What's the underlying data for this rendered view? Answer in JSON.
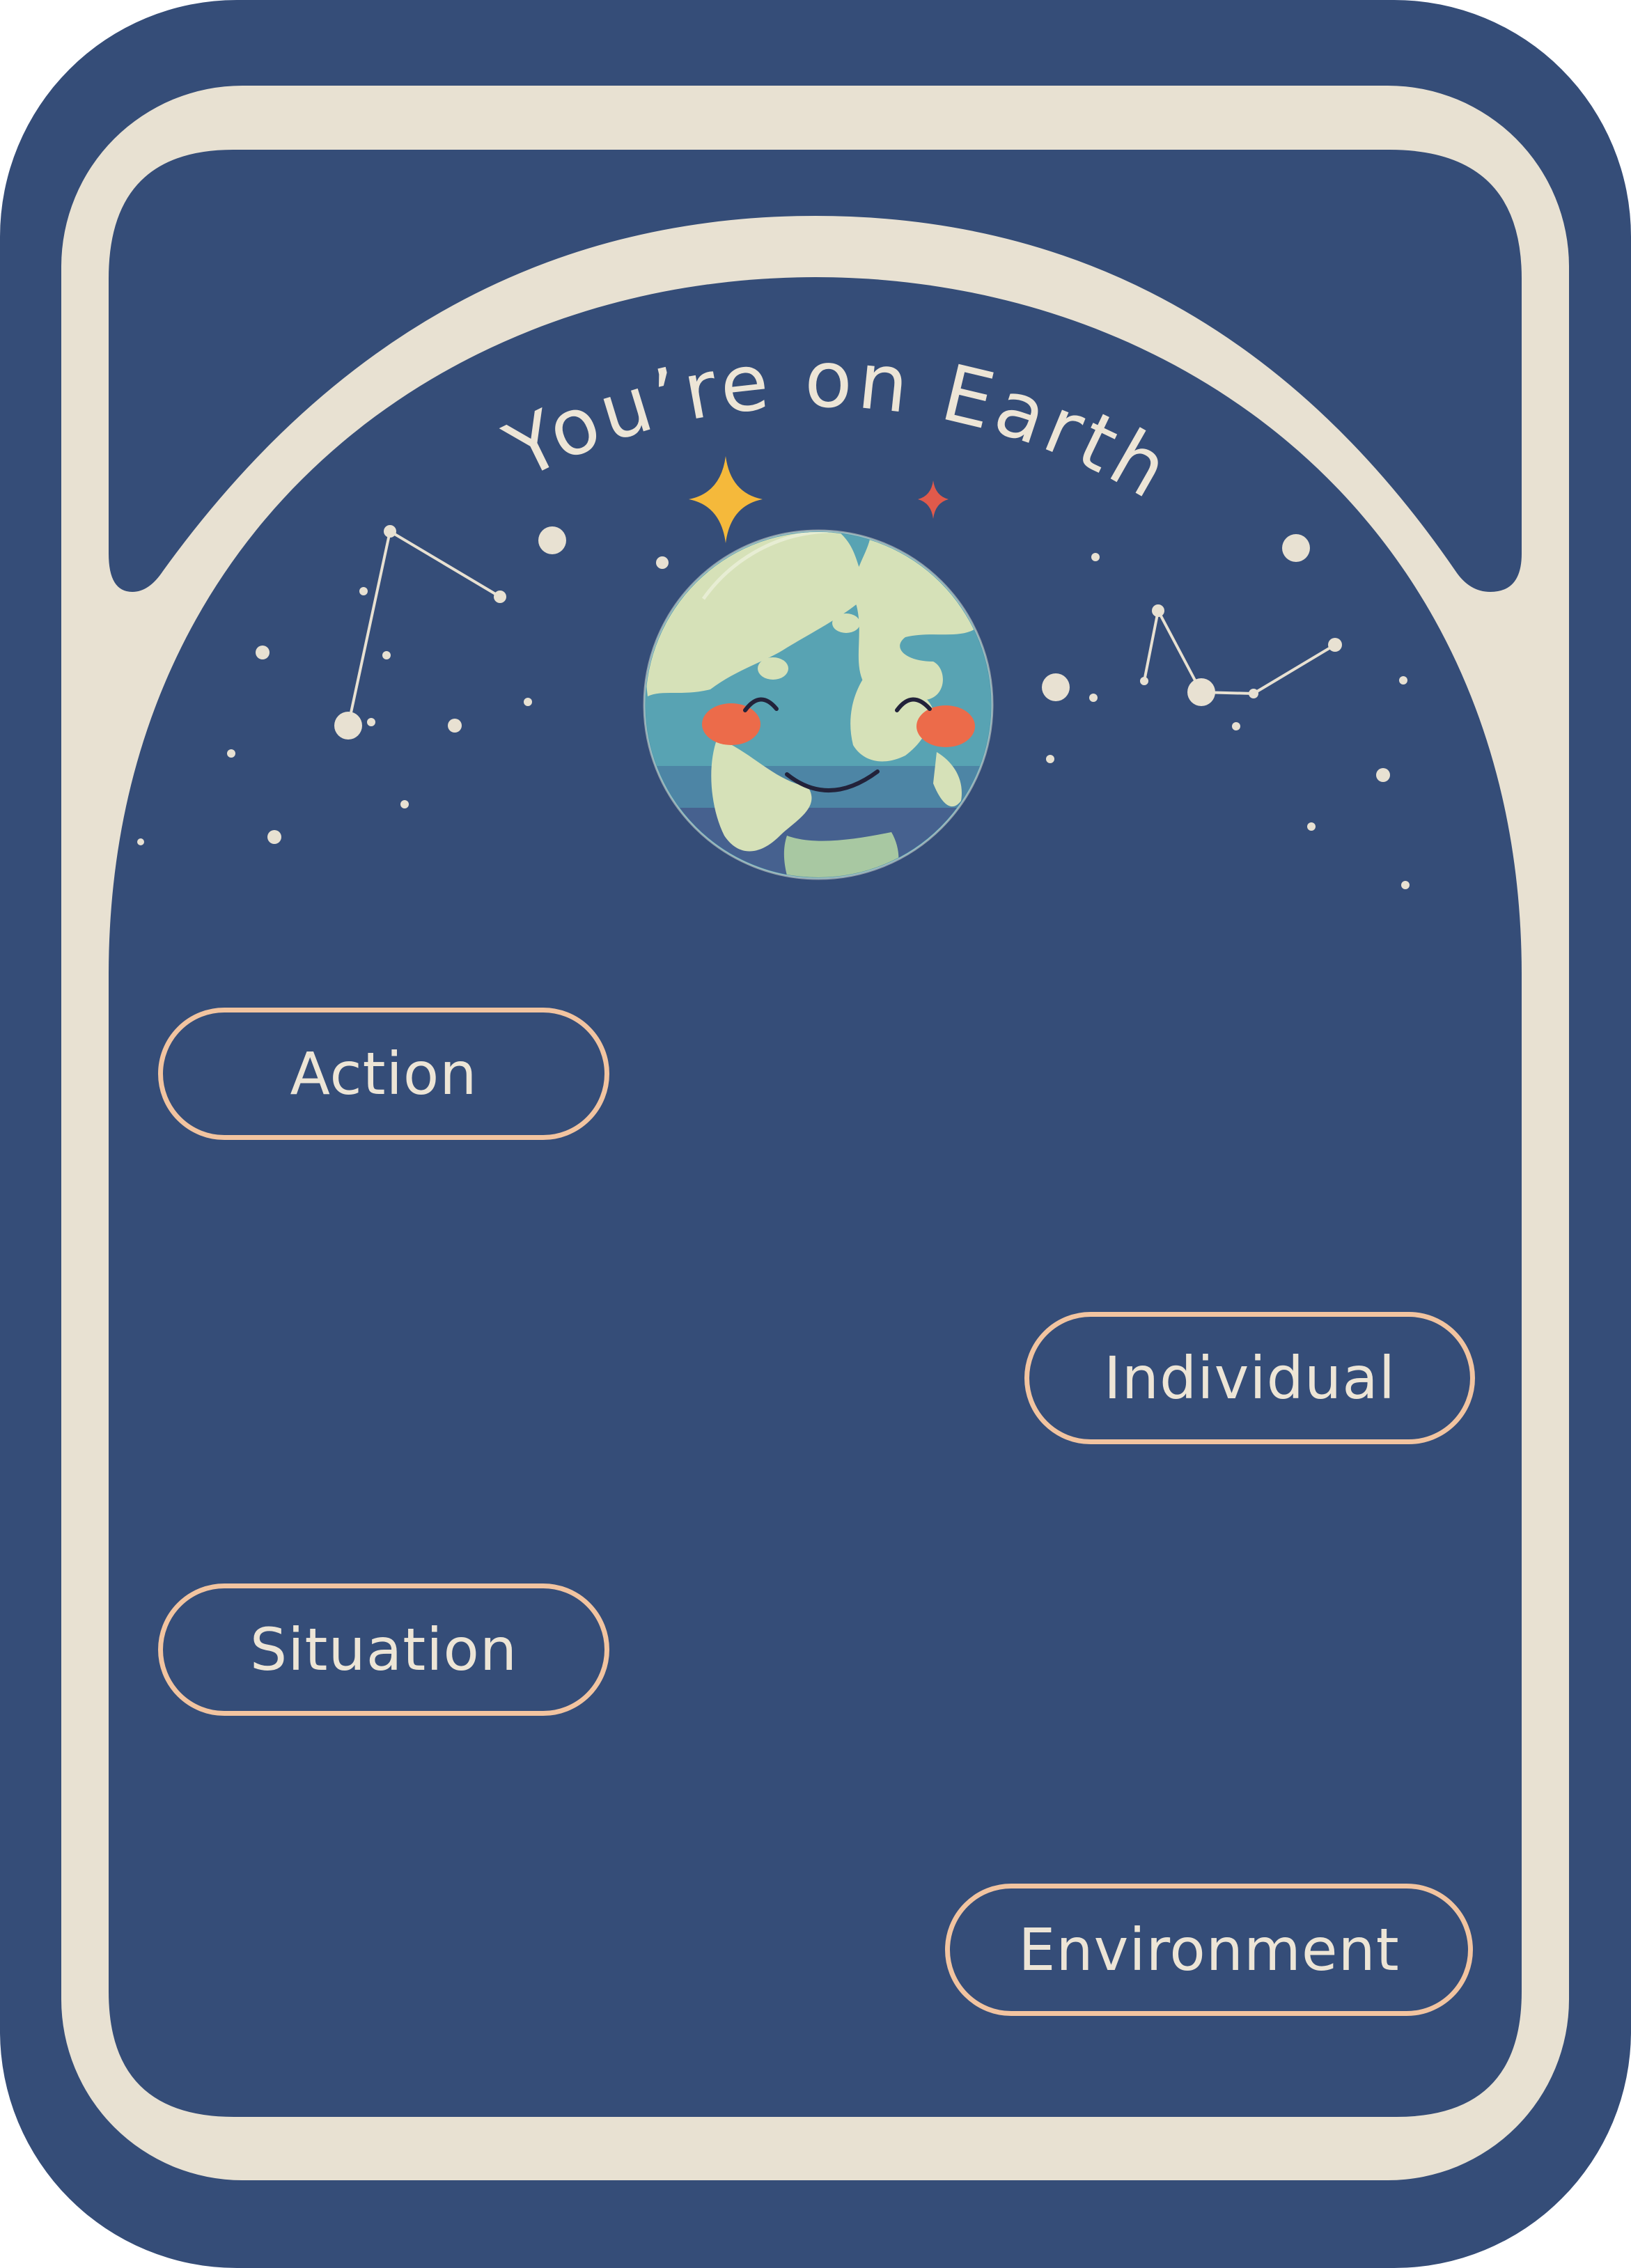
{
  "card": {
    "title": "You’re on Earth",
    "background_color": "#354d78",
    "frame_color": "#e8e1d2",
    "pill_border_color": "#f2c4a0",
    "mascot_icon": "smiling-earth-icon"
  },
  "pills": {
    "action": "Action",
    "individual": "Individual",
    "situation": "Situation",
    "environment": "Environment"
  }
}
